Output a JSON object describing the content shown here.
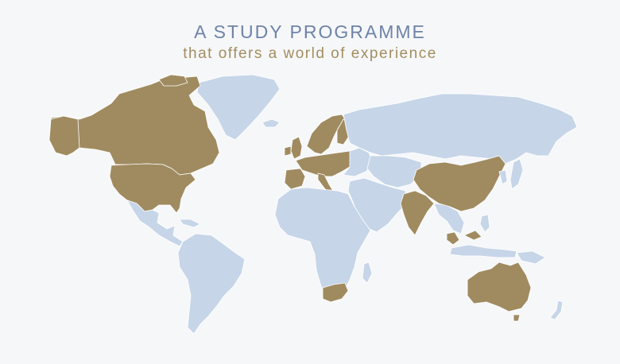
{
  "header": {
    "title": "A STUDY PROGRAMME",
    "subtitle": "that offers a world of experience"
  },
  "colors": {
    "background": "#f6f7f9",
    "land_default": "#c6d5e8",
    "land_highlight": "#a08b60",
    "title": "#6e83a8",
    "subtitle": "#a38e5f"
  },
  "highlighted_countries": [
    "Canada",
    "United States",
    "United Kingdom",
    "Ireland",
    "Norway",
    "Sweden",
    "Finland",
    "France",
    "Spain",
    "Portugal",
    "Netherlands",
    "Germany",
    "Poland",
    "Czech Republic",
    "Austria",
    "Italy",
    "Hungary",
    "Romania",
    "Lithuania",
    "China",
    "India",
    "Malaysia",
    "Singapore",
    "Australia",
    "South Africa"
  ]
}
